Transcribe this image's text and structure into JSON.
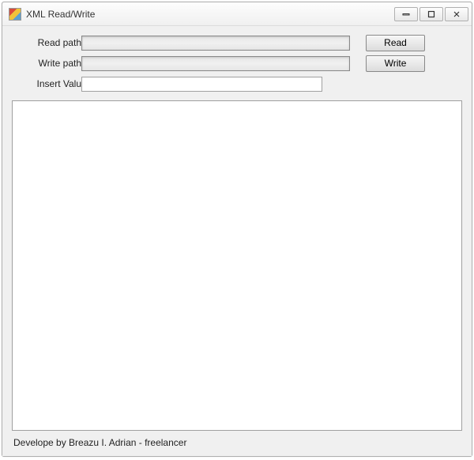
{
  "window": {
    "title": "XML Read/Write"
  },
  "labels": {
    "read_path": "Read path",
    "write_path": "Write path",
    "insert_value": "Insert Valu"
  },
  "inputs": {
    "read_path_value": "",
    "write_path_value": "",
    "insert_value_value": "",
    "output_value": ""
  },
  "buttons": {
    "read": "Read",
    "write": "Write"
  },
  "footer": {
    "credit": "Develope by Breazu I. Adrian - freelancer"
  }
}
